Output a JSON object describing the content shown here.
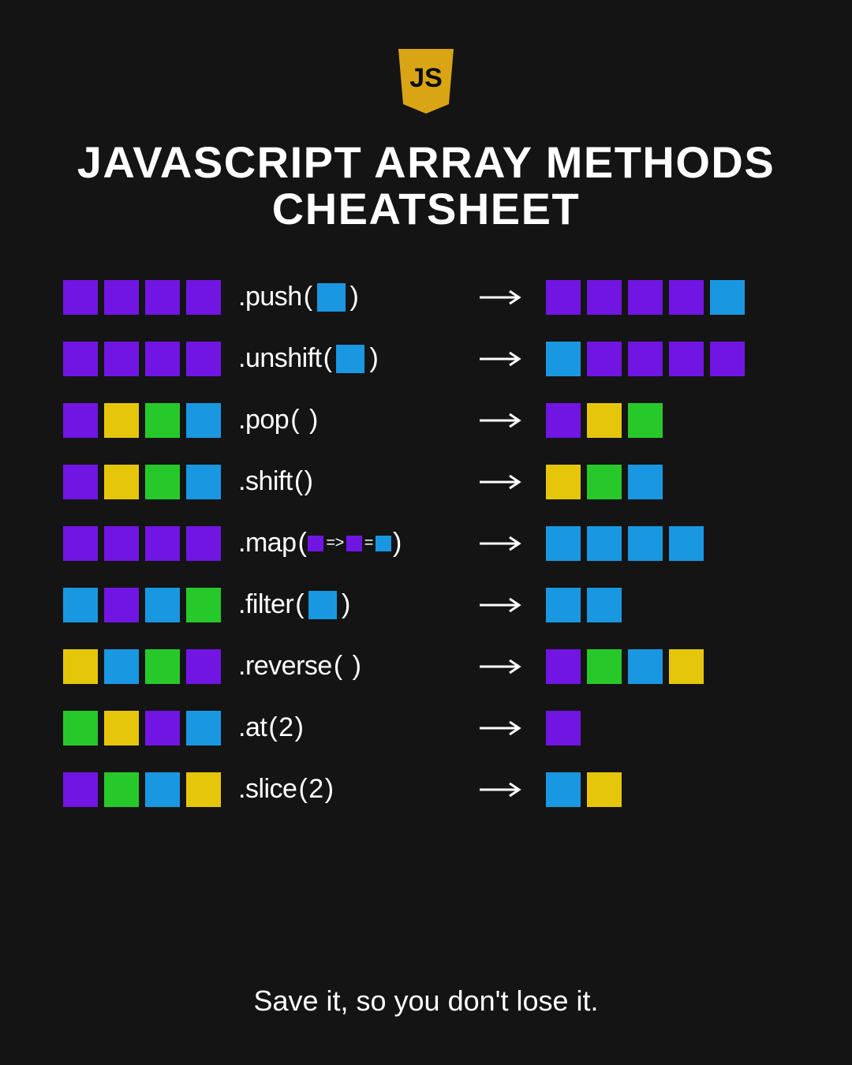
{
  "logo_text": "JS",
  "title_line1": "JAVASCRIPT ARRAY METHODS",
  "title_line2": "CHEATSHEET",
  "footer": "Save it, so you don't lose it.",
  "colors": {
    "purple": "#7115E3",
    "blue": "#1998E1",
    "yellow": "#E6C60A",
    "green": "#27C92A",
    "logo": "#D9A514",
    "logo_text": "#0C0C0C",
    "text": "#FFFFFF"
  },
  "rows": [
    {
      "input": [
        "purple",
        "purple",
        "purple",
        "purple"
      ],
      "method": {
        "name": ".push",
        "arg_type": "box",
        "arg": [
          "blue"
        ]
      },
      "output": [
        "purple",
        "purple",
        "purple",
        "purple",
        "blue"
      ]
    },
    {
      "input": [
        "purple",
        "purple",
        "purple",
        "purple"
      ],
      "method": {
        "name": ".unshift",
        "arg_type": "box",
        "arg": [
          "blue"
        ]
      },
      "output": [
        "blue",
        "purple",
        "purple",
        "purple",
        "purple"
      ]
    },
    {
      "input": [
        "purple",
        "yellow",
        "green",
        "blue"
      ],
      "method": {
        "name": ".pop",
        "arg_type": "none",
        "arg_text": " "
      },
      "output": [
        "purple",
        "yellow",
        "green"
      ]
    },
    {
      "input": [
        "purple",
        "yellow",
        "green",
        "blue"
      ],
      "method": {
        "name": ".shift",
        "arg_type": "none",
        "arg_text": ""
      },
      "output": [
        "yellow",
        "green",
        "blue"
      ]
    },
    {
      "input": [
        "purple",
        "purple",
        "purple",
        "purple"
      ],
      "method": {
        "name": ".map",
        "arg_type": "map",
        "from": "purple",
        "to": "blue"
      },
      "output": [
        "blue",
        "blue",
        "blue",
        "blue"
      ]
    },
    {
      "input": [
        "blue",
        "purple",
        "blue",
        "green"
      ],
      "method": {
        "name": ".filter",
        "arg_type": "box",
        "arg": [
          "blue"
        ]
      },
      "output": [
        "blue",
        "blue"
      ]
    },
    {
      "input": [
        "yellow",
        "blue",
        "green",
        "purple"
      ],
      "method": {
        "name": ".reverse",
        "arg_type": "none",
        "arg_text": " "
      },
      "output": [
        "purple",
        "green",
        "blue",
        "yellow"
      ]
    },
    {
      "input": [
        "green",
        "yellow",
        "purple",
        "blue"
      ],
      "method": {
        "name": ".at",
        "arg_type": "text",
        "arg_text": "2"
      },
      "output": [
        "purple"
      ]
    },
    {
      "input": [
        "purple",
        "green",
        "blue",
        "yellow"
      ],
      "method": {
        "name": ".slice",
        "arg_type": "text",
        "arg_text": "2"
      },
      "output": [
        "blue",
        "yellow"
      ]
    }
  ]
}
